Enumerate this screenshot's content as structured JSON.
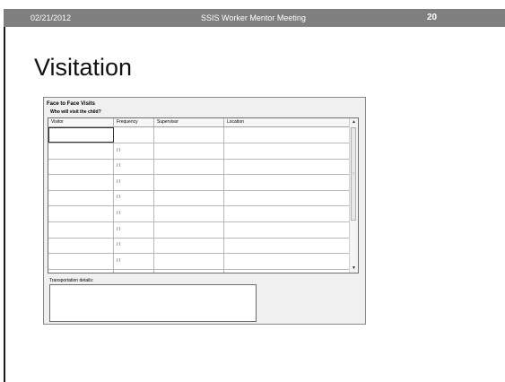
{
  "header": {
    "date": "02/21/2012",
    "title": "SSIS Worker Mentor Meeting",
    "page_number": "20"
  },
  "slide": {
    "title": "Visitation"
  },
  "form": {
    "title": "Face to Face Visits",
    "question": "Who will visit the child?",
    "columns": [
      "Visitor",
      "Frequency",
      "Supervisor",
      "Location"
    ],
    "rows": [
      {
        "visitor": "",
        "frequency": "",
        "supervisor": "",
        "location": ""
      },
      {
        "visitor": "",
        "frequency": "/ /",
        "supervisor": "",
        "location": ""
      },
      {
        "visitor": "",
        "frequency": "/ /",
        "supervisor": "",
        "location": ""
      },
      {
        "visitor": "",
        "frequency": "/ /",
        "supervisor": "",
        "location": ""
      },
      {
        "visitor": "",
        "frequency": "/ /",
        "supervisor": "",
        "location": ""
      },
      {
        "visitor": "",
        "frequency": "/ /",
        "supervisor": "",
        "location": ""
      },
      {
        "visitor": "",
        "frequency": "/ /",
        "supervisor": "",
        "location": ""
      },
      {
        "visitor": "",
        "frequency": "/ /",
        "supervisor": "",
        "location": ""
      },
      {
        "visitor": "",
        "frequency": "/ /",
        "supervisor": "",
        "location": ""
      },
      {
        "visitor": "",
        "frequency": "/ /",
        "supervisor": "",
        "location": ""
      }
    ],
    "scroll_up_icon": "chevron-up-icon",
    "scroll_down_icon": "chevron-down-icon",
    "transportation_label": "Transportation details:",
    "transportation_value": ""
  },
  "colors": {
    "header_bg": "#7f7f7f",
    "header_text": "#ffffff",
    "form_bg": "#f0f0f0"
  }
}
